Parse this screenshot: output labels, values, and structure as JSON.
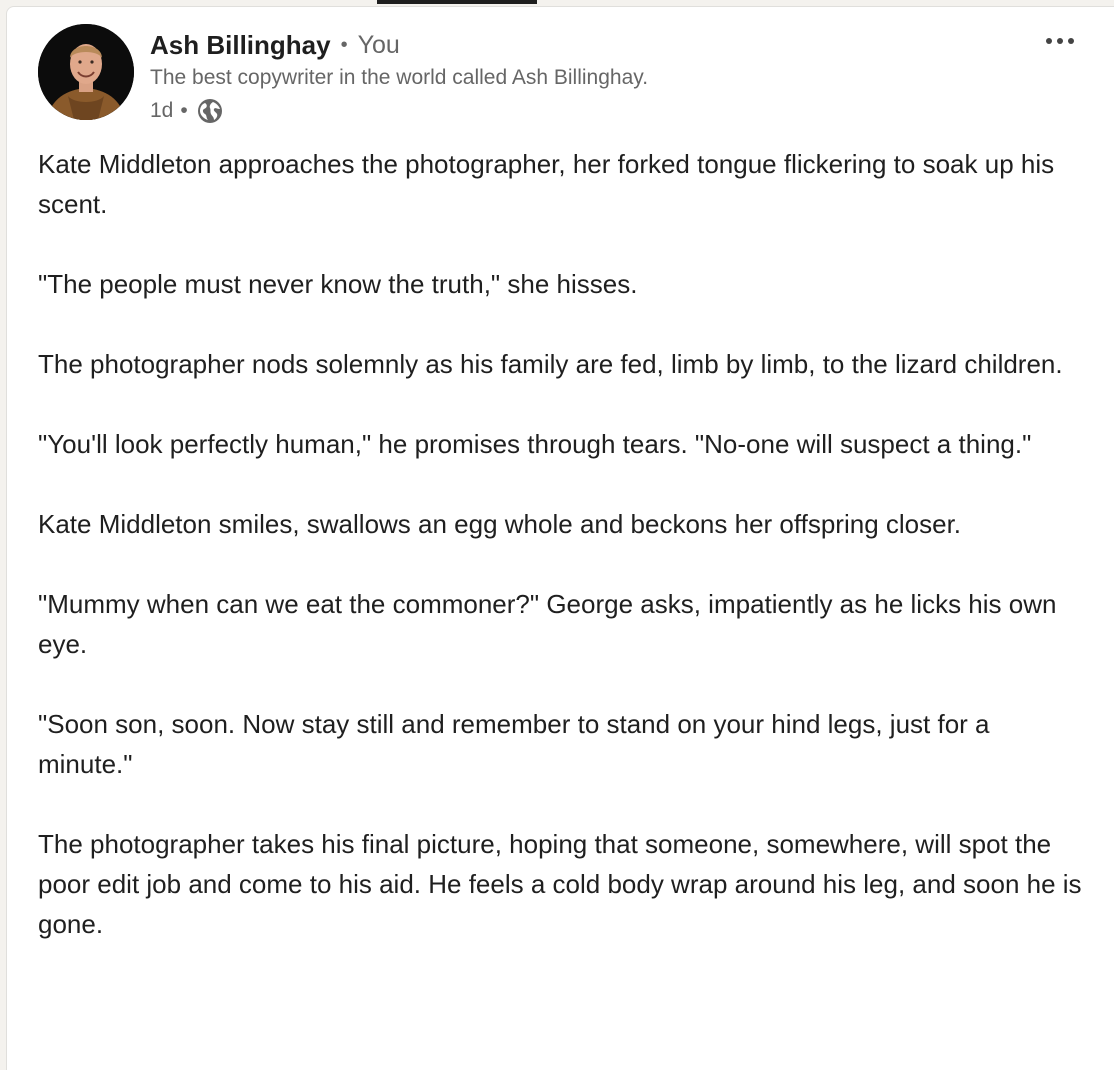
{
  "post": {
    "author": {
      "name": "Ash Billinghay",
      "separator": "•",
      "relation": "You",
      "headline": "The best copywriter in the world called Ash Billinghay.",
      "avatar_icon": "profile-photo"
    },
    "meta": {
      "time": "1d",
      "separator": "•",
      "visibility_icon": "globe-icon"
    },
    "menu_icon": "more-horizontal-icon",
    "paragraphs": [
      "Kate Middleton approaches the photographer, her forked tongue flickering to soak up his scent.",
      "\"The people must never know the truth,\" she hisses.",
      "The photographer nods solemnly as his family are fed, limb by limb, to the lizard children.",
      "\"You'll look perfectly human,\" he promises through tears. \"No-one will suspect a thing.\"",
      "Kate Middleton smiles, swallows an egg whole and beckons her offspring closer.",
      "\"Mummy when can we eat the commoner?\" George asks, impatiently as he licks his own eye.",
      "\"Soon son, soon. Now stay still and remember to stand on your hind legs, just for a minute.\"",
      "The photographer takes his final picture, hoping that someone, somewhere, will spot the poor edit job and come to his aid. He feels a cold body wrap around his leg, and soon he is gone."
    ]
  },
  "colors": {
    "text_primary": "#1f1f1f",
    "text_secondary": "#666666",
    "background": "#ffffff",
    "page_background": "#f4f2ee"
  }
}
